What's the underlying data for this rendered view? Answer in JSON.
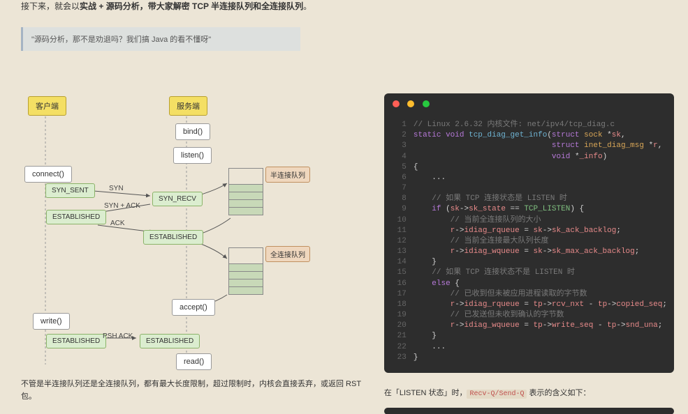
{
  "intro": {
    "pre": "接下来，就会以",
    "bold": "实战 + 源码分析，带大家解密 TCP 半连接队列和全连接队列",
    "post": "。"
  },
  "quote": "\"源码分析，那不是劝退吗？我们搞 Java 的看不懂呀\"",
  "diagram": {
    "client": "客户端",
    "server": "服务端",
    "bind": "bind()",
    "listen": "listen()",
    "connect": "connect()",
    "syn_sent": "SYN_SENT",
    "syn_recv": "SYN_RECV",
    "established": "ESTABLISHED",
    "accept": "accept()",
    "write": "write()",
    "read": "read()",
    "syn": "SYN",
    "syn_ack": "SYN + ACK",
    "ack": "ACK",
    "psh_ack": "PSH ACK",
    "half_queue": "半连接队列",
    "full_queue": "全连接队列"
  },
  "after_diagram": "不管是半连接队列还是全连接队列，都有最大长度限制，超过限制时，内核会直接丢弃，或返回 RST 包。",
  "code": {
    "file_comment": "Linux 2.6.32 内核文件: net/ipv4/tcp_diag.c",
    "lines": [
      {
        "n": 1,
        "seg": [
          {
            "t": "// Linux 2.6.32 内核文件: net/ipv4/tcp_diag.c",
            "c": "c-comment"
          }
        ]
      },
      {
        "n": 2,
        "seg": [
          {
            "t": "static void ",
            "c": "c-keyword"
          },
          {
            "t": "tcp_diag_get_info",
            "c": "c-func"
          },
          {
            "t": "(",
            "c": "c-plain"
          },
          {
            "t": "struct ",
            "c": "c-keyword"
          },
          {
            "t": "sock ",
            "c": "c-struct"
          },
          {
            "t": "*",
            "c": "c-op"
          },
          {
            "t": "sk",
            "c": "c-var"
          },
          {
            "t": ",",
            "c": "c-plain"
          }
        ]
      },
      {
        "n": 3,
        "seg": [
          {
            "t": "                              ",
            "c": "c-plain"
          },
          {
            "t": "struct ",
            "c": "c-keyword"
          },
          {
            "t": "inet_diag_msg ",
            "c": "c-struct"
          },
          {
            "t": "*",
            "c": "c-op"
          },
          {
            "t": "r",
            "c": "c-var"
          },
          {
            "t": ",",
            "c": "c-plain"
          }
        ]
      },
      {
        "n": 4,
        "seg": [
          {
            "t": "                              ",
            "c": "c-plain"
          },
          {
            "t": "void ",
            "c": "c-keyword"
          },
          {
            "t": "*",
            "c": "c-op"
          },
          {
            "t": "_info",
            "c": "c-var"
          },
          {
            "t": ")",
            "c": "c-plain"
          }
        ]
      },
      {
        "n": 5,
        "seg": [
          {
            "t": "{",
            "c": "c-plain"
          }
        ]
      },
      {
        "n": 6,
        "seg": [
          {
            "t": "    ...",
            "c": "c-plain"
          }
        ]
      },
      {
        "n": 7,
        "seg": [
          {
            "t": "",
            "c": "c-plain"
          }
        ]
      },
      {
        "n": 8,
        "seg": [
          {
            "t": "    // 如果 TCP 连接状态是 LISTEN 时",
            "c": "c-comment"
          }
        ]
      },
      {
        "n": 9,
        "seg": [
          {
            "t": "    ",
            "c": "c-plain"
          },
          {
            "t": "if ",
            "c": "c-keyword"
          },
          {
            "t": "(",
            "c": "c-plain"
          },
          {
            "t": "sk",
            "c": "c-var"
          },
          {
            "t": "->",
            "c": "c-op"
          },
          {
            "t": "sk_state",
            "c": "c-field"
          },
          {
            "t": " == ",
            "c": "c-op"
          },
          {
            "t": "TCP_LISTEN",
            "c": "c-const"
          },
          {
            "t": ") {",
            "c": "c-plain"
          }
        ]
      },
      {
        "n": 10,
        "seg": [
          {
            "t": "        // 当前全连接队列的大小",
            "c": "c-comment"
          }
        ]
      },
      {
        "n": 11,
        "seg": [
          {
            "t": "        ",
            "c": "c-plain"
          },
          {
            "t": "r",
            "c": "c-var"
          },
          {
            "t": "->",
            "c": "c-op"
          },
          {
            "t": "idiag_rqueue",
            "c": "c-field"
          },
          {
            "t": " = ",
            "c": "c-op"
          },
          {
            "t": "sk",
            "c": "c-var"
          },
          {
            "t": "->",
            "c": "c-op"
          },
          {
            "t": "sk_ack_backlog",
            "c": "c-field"
          },
          {
            "t": ";",
            "c": "c-plain"
          }
        ]
      },
      {
        "n": 12,
        "seg": [
          {
            "t": "        // 当前全连接最大队列长度",
            "c": "c-comment"
          }
        ]
      },
      {
        "n": 13,
        "seg": [
          {
            "t": "        ",
            "c": "c-plain"
          },
          {
            "t": "r",
            "c": "c-var"
          },
          {
            "t": "->",
            "c": "c-op"
          },
          {
            "t": "idiag_wqueue",
            "c": "c-field"
          },
          {
            "t": " = ",
            "c": "c-op"
          },
          {
            "t": "sk",
            "c": "c-var"
          },
          {
            "t": "->",
            "c": "c-op"
          },
          {
            "t": "sk_max_ack_backlog",
            "c": "c-field"
          },
          {
            "t": ";",
            "c": "c-plain"
          }
        ]
      },
      {
        "n": 14,
        "seg": [
          {
            "t": "    }",
            "c": "c-plain"
          }
        ]
      },
      {
        "n": 15,
        "seg": [
          {
            "t": "    // 如果 TCP 连接状态不是 LISTEN 时",
            "c": "c-comment"
          }
        ]
      },
      {
        "n": 16,
        "seg": [
          {
            "t": "    ",
            "c": "c-plain"
          },
          {
            "t": "else ",
            "c": "c-keyword"
          },
          {
            "t": "{",
            "c": "c-plain"
          }
        ]
      },
      {
        "n": 17,
        "seg": [
          {
            "t": "        // 已收到但未被应用进程读取的字节数",
            "c": "c-comment"
          }
        ]
      },
      {
        "n": 18,
        "seg": [
          {
            "t": "        ",
            "c": "c-plain"
          },
          {
            "t": "r",
            "c": "c-var"
          },
          {
            "t": "->",
            "c": "c-op"
          },
          {
            "t": "idiag_rqueue",
            "c": "c-field"
          },
          {
            "t": " = ",
            "c": "c-op"
          },
          {
            "t": "tp",
            "c": "c-var"
          },
          {
            "t": "->",
            "c": "c-op"
          },
          {
            "t": "rcv_nxt",
            "c": "c-field"
          },
          {
            "t": " - ",
            "c": "c-op"
          },
          {
            "t": "tp",
            "c": "c-var"
          },
          {
            "t": "->",
            "c": "c-op"
          },
          {
            "t": "copied_seq",
            "c": "c-field"
          },
          {
            "t": ";",
            "c": "c-plain"
          }
        ]
      },
      {
        "n": 19,
        "seg": [
          {
            "t": "        // 已发送但未收到确认的字节数",
            "c": "c-comment"
          }
        ]
      },
      {
        "n": 20,
        "seg": [
          {
            "t": "        ",
            "c": "c-plain"
          },
          {
            "t": "r",
            "c": "c-var"
          },
          {
            "t": "->",
            "c": "c-op"
          },
          {
            "t": "idiag_wqueue",
            "c": "c-field"
          },
          {
            "t": " = ",
            "c": "c-op"
          },
          {
            "t": "tp",
            "c": "c-var"
          },
          {
            "t": "->",
            "c": "c-op"
          },
          {
            "t": "write_seq",
            "c": "c-field"
          },
          {
            "t": " - ",
            "c": "c-op"
          },
          {
            "t": "tp",
            "c": "c-var"
          },
          {
            "t": "->",
            "c": "c-op"
          },
          {
            "t": "snd_una",
            "c": "c-field"
          },
          {
            "t": ";",
            "c": "c-plain"
          }
        ]
      },
      {
        "n": 21,
        "seg": [
          {
            "t": "    }",
            "c": "c-plain"
          }
        ]
      },
      {
        "n": 22,
        "seg": [
          {
            "t": "    ...",
            "c": "c-plain"
          }
        ]
      },
      {
        "n": 23,
        "seg": [
          {
            "t": "}",
            "c": "c-plain"
          }
        ]
      }
    ]
  },
  "after_code": {
    "pre": "在「LISTEN 状态」时，",
    "code": "Recv-Q/Send-Q",
    "post": " 表示的含义如下："
  }
}
